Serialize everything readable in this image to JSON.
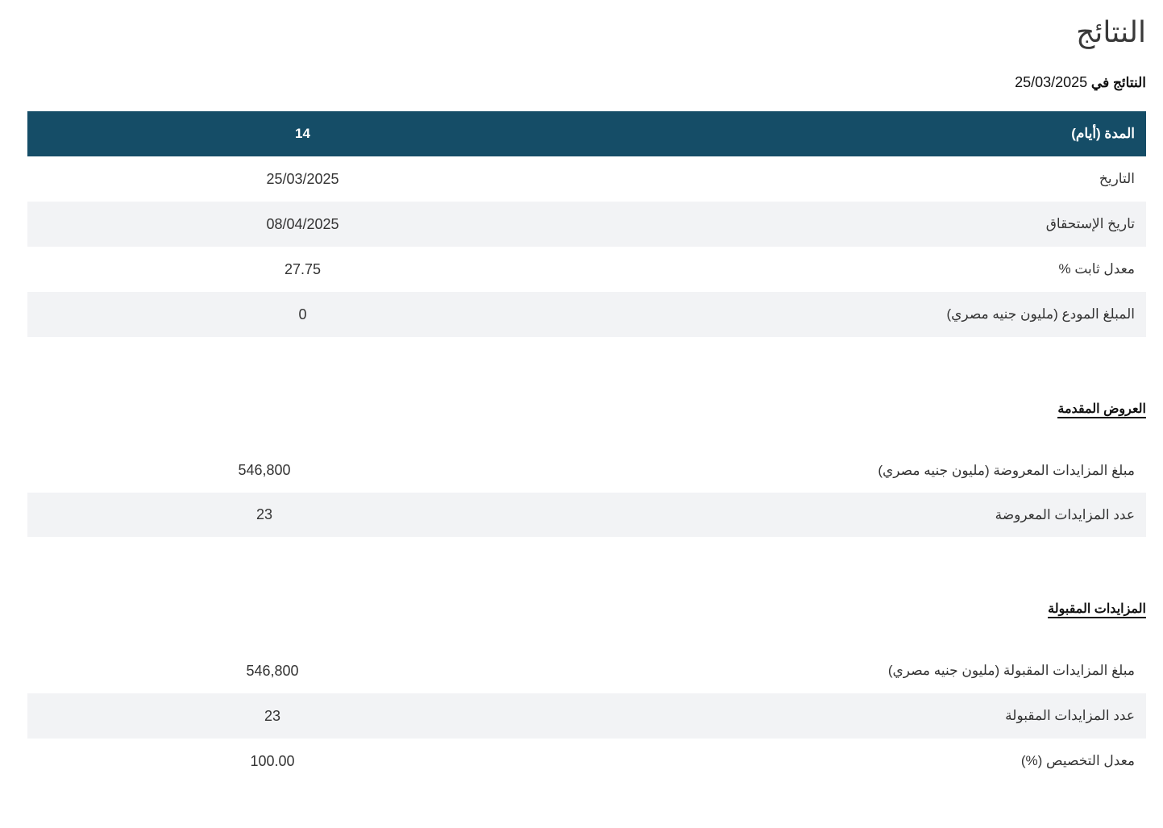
{
  "page": {
    "title": "النتائج",
    "subtitle_prefix": "النتائج في",
    "subtitle_date": "25/03/2025"
  },
  "main_table": {
    "header": {
      "label": "المدة (أيام)",
      "value": "14"
    },
    "rows": [
      {
        "label": "التاريخ",
        "value": "25/03/2025"
      },
      {
        "label": "تاريخ الإستحقاق",
        "value": "08/04/2025"
      },
      {
        "label": "معدل ثابت %",
        "value": "27.75"
      },
      {
        "label": "المبلغ المودع (مليون جنيه مصري)",
        "value": "0"
      }
    ]
  },
  "offers": {
    "title": "العروض المقدمة",
    "rows": [
      {
        "label": "مبلغ المزايدات المعروضة (مليون جنيه مصري)",
        "value": "546,800"
      },
      {
        "label": "عدد المزايدات المعروضة",
        "value": "23"
      }
    ]
  },
  "accepted": {
    "title": "المزايدات المقبولة",
    "rows": [
      {
        "label": "مبلغ المزايدات المقبولة (مليون جنيه مصري)",
        "value": "546,800"
      },
      {
        "label": "عدد المزايدات المقبولة",
        "value": "23"
      },
      {
        "label": "معدل التخصيص (%)",
        "value": "100.00"
      }
    ]
  },
  "colors": {
    "header_bg": "#154d67",
    "row_alt_bg": "#f2f3f5"
  }
}
